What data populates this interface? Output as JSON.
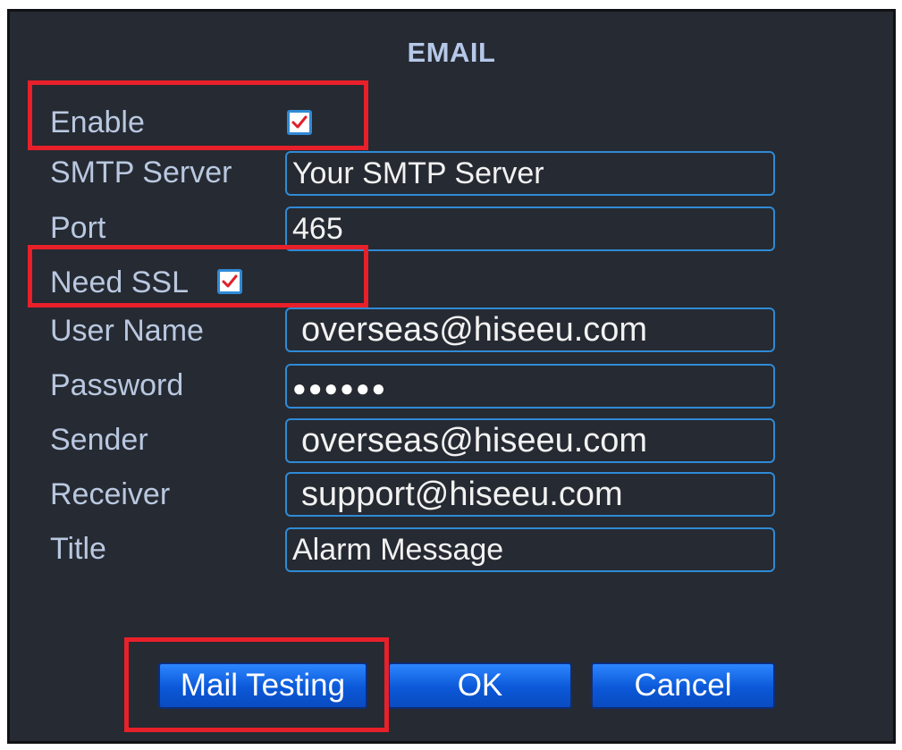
{
  "dialog": {
    "title": "EMAIL"
  },
  "fields": {
    "enable": {
      "label": "Enable",
      "checked": true
    },
    "smtp_server": {
      "label": "SMTP Server",
      "value": "Your SMTP Server"
    },
    "port": {
      "label": "Port",
      "value": "465"
    },
    "need_ssl": {
      "label": "Need SSL",
      "checked": true
    },
    "user_name": {
      "label": "User Name",
      "value": "overseas@hiseeu.com"
    },
    "password": {
      "label": "Password",
      "value": "●●●●●●"
    },
    "sender": {
      "label": "Sender",
      "value": "overseas@hiseeu.com"
    },
    "receiver": {
      "label": "Receiver",
      "value": "support@hiseeu.com"
    },
    "title": {
      "label": "Title",
      "value": "Alarm Message"
    }
  },
  "buttons": {
    "mail_testing": "Mail Testing",
    "ok": "OK",
    "cancel": "Cancel"
  },
  "colors": {
    "background": "#262a32",
    "field_border": "#2f8ad6",
    "label_text": "#b9c8e0",
    "highlight": "#e8202a",
    "button": "#0b58d8"
  },
  "icons": {
    "checkbox": "check-icon"
  }
}
